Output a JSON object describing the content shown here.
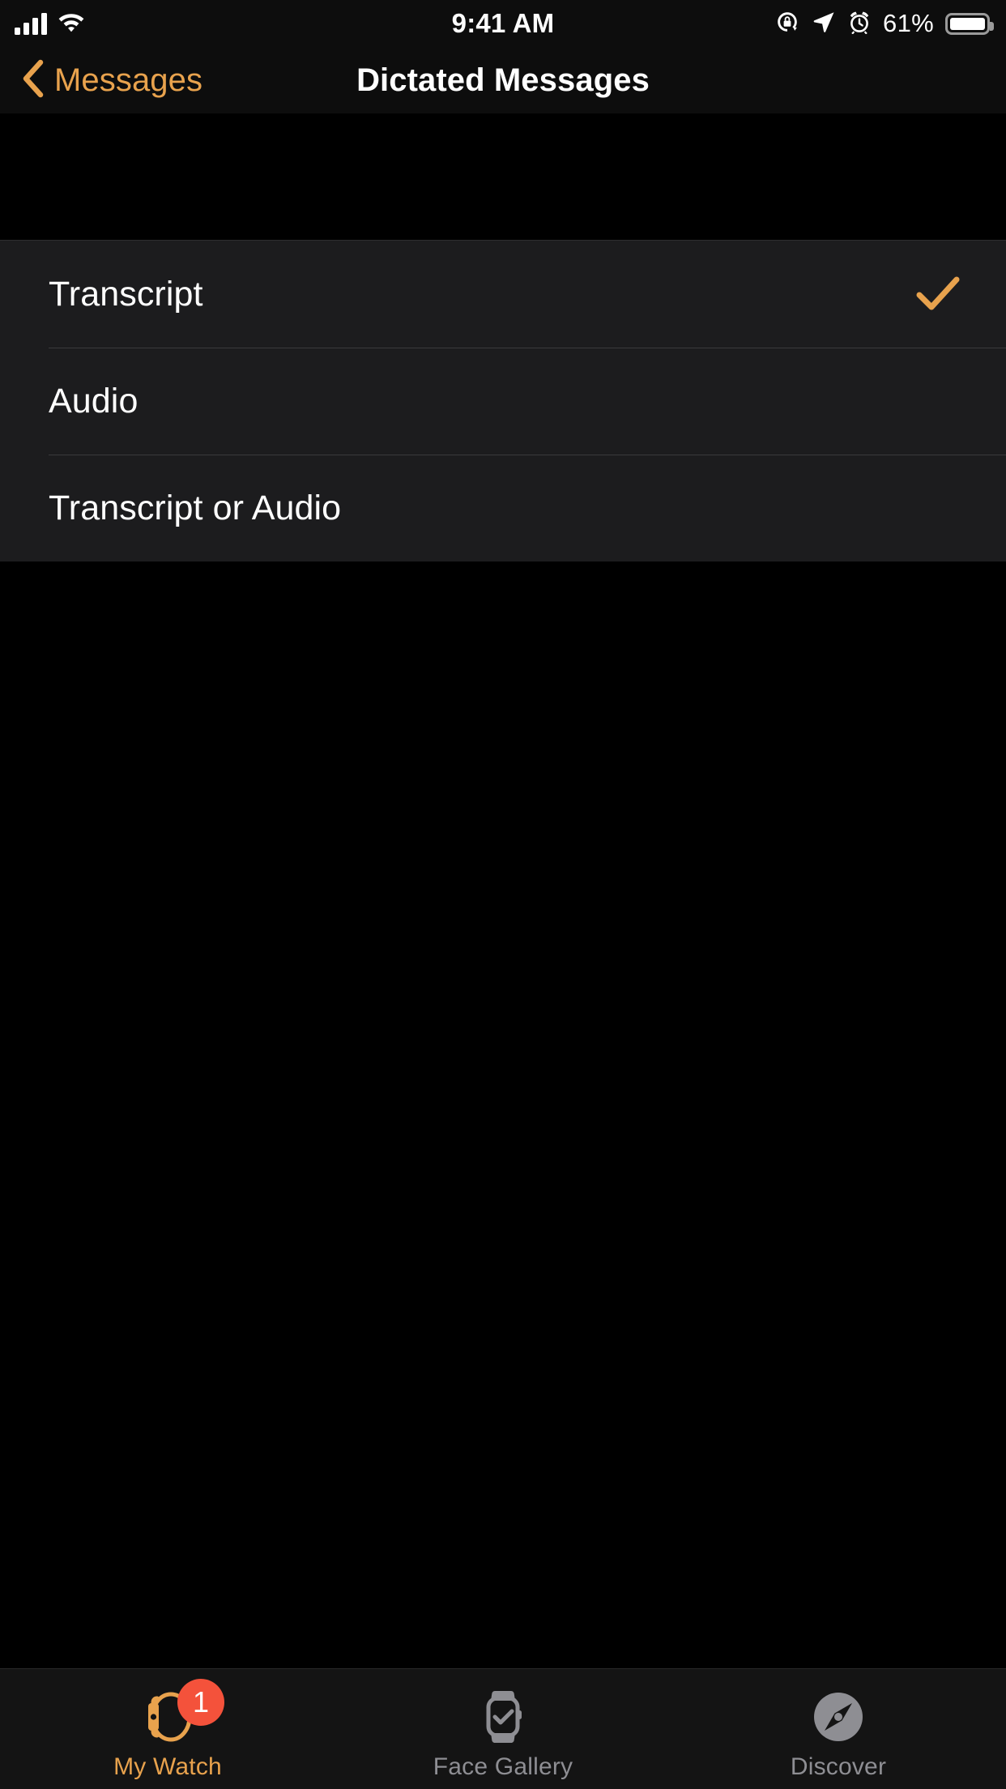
{
  "status_bar": {
    "time": "9:41 AM",
    "battery_percent": "61%",
    "icons": {
      "cellular": "cellular-signal-icon",
      "wifi": "wifi-icon",
      "rotation_lock": "rotation-lock-icon",
      "location": "location-arrow-icon",
      "alarm": "alarm-clock-icon",
      "battery": "battery-icon"
    }
  },
  "nav_bar": {
    "back_label": "Messages",
    "back_icon": "chevron-left-icon",
    "title": "Dictated Messages"
  },
  "options": {
    "items": [
      {
        "label": "Transcript",
        "selected": true
      },
      {
        "label": "Audio",
        "selected": false
      },
      {
        "label": "Transcript or Audio",
        "selected": false
      }
    ],
    "checkmark_icon": "checkmark-icon"
  },
  "tab_bar": {
    "tabs": [
      {
        "label": "My Watch",
        "icon": "apple-watch-side-icon",
        "active": true,
        "badge": "1"
      },
      {
        "label": "Face Gallery",
        "icon": "watch-face-checkmark-icon",
        "active": false,
        "badge": ""
      },
      {
        "label": "Discover",
        "icon": "compass-icon",
        "active": false,
        "badge": ""
      }
    ]
  },
  "colors": {
    "accent": "#e8a24d",
    "badge": "#f4523b",
    "inactive": "#8e8e93",
    "row_background": "#1c1c1e",
    "background": "#000000"
  }
}
